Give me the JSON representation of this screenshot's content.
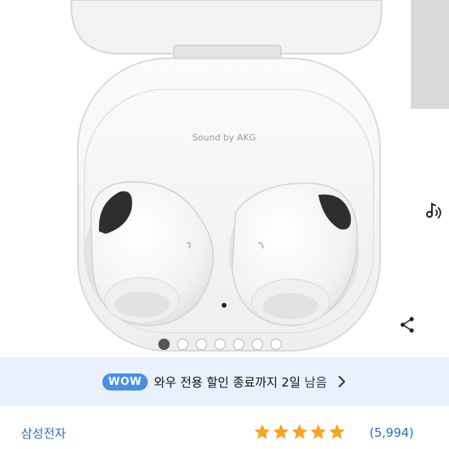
{
  "product": {
    "case_brand_text": "Sound by AKG",
    "image_count": 7,
    "active_image_index": 0
  },
  "icons": {
    "sound": "music-note-icon",
    "share": "share-icon",
    "chevron": "chevron-right-icon",
    "star": "star-icon"
  },
  "promo": {
    "badge": "WOW",
    "text": "와우 전용 할인 종료까지 2일",
    "remaining": "남음"
  },
  "seller": {
    "name": "삼성전자"
  },
  "rating": {
    "stars": 5,
    "review_count": "(5,994)"
  },
  "colors": {
    "accent": "#4a90e2",
    "promo_bg": "#e8f1fc",
    "link": "#2b6cc4",
    "star": "#f5a623"
  }
}
